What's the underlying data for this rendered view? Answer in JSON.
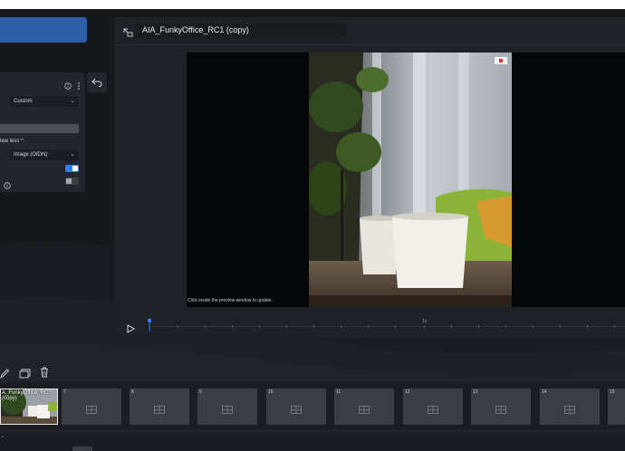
{
  "preview": {
    "clip_title": "AIA_FunkyOffice_RC1 (copy)",
    "hint": "Click inside the preview window to update.",
    "timeline_tick_label": "1s"
  },
  "properties": {
    "preset_value": "Custom",
    "show_less_label": "iew less ^",
    "mode_value": "Image (OIDN)"
  },
  "timeline": {
    "first_clip_label_line1": "A_FunkyOffice_RC",
    "first_clip_label_line2": "(copy)",
    "frames": [
      "7",
      "8",
      "9",
      "10",
      "11",
      "12",
      "13",
      "14",
      "15"
    ]
  },
  "colors": {
    "accent": "#2f5ea8",
    "toggle_on": "#2d7ff9",
    "panel": "#23262c",
    "background": "#16181c"
  },
  "icons": {
    "preview_header": "film-expand-icon",
    "undo": "undo-icon",
    "info": "info-icon",
    "more": "more-vertical-icon",
    "play": "play-icon",
    "edit": "pencil-icon",
    "copy": "copy-icon",
    "delete": "trash-icon",
    "frame_placeholder": "film-frame-icon"
  }
}
